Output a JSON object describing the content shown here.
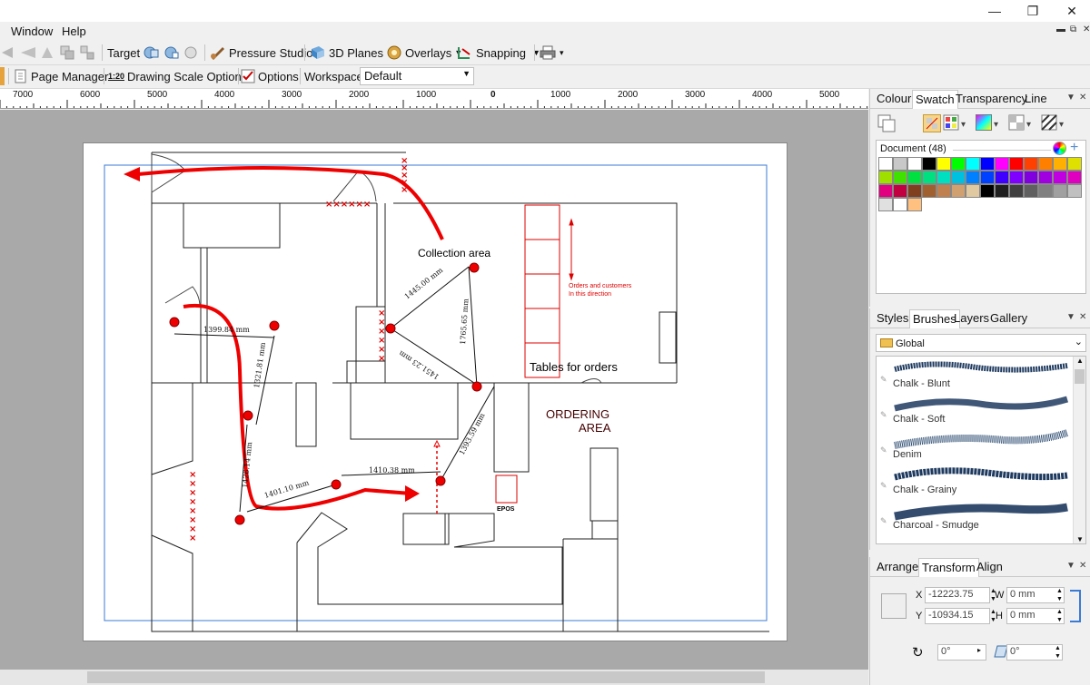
{
  "menu": {
    "window": "Window",
    "help": "Help"
  },
  "toolbar1": {
    "target": "Target",
    "pressure_studio": "Pressure Studio",
    "planes_3d": "3D Planes",
    "overlays": "Overlays",
    "snapping": "Snapping"
  },
  "toolbar2": {
    "page_manager": "Page Manager",
    "scale_badge": "1:20",
    "drawing_scale_options": "Drawing Scale Options",
    "options": "Options",
    "workspace_label": "Workspace",
    "workspace_value": "Default"
  },
  "ruler": {
    "labels": [
      "7000",
      "6000",
      "5000",
      "4000",
      "3000",
      "2000",
      "1000",
      "0",
      "1000",
      "2000",
      "3000",
      "4000",
      "5000"
    ]
  },
  "drawing": {
    "collection_area": "Collection area",
    "orders_direction_1": "Orders and customers",
    "orders_direction_2": "In this direction",
    "tables_for_orders": "Tables for orders",
    "ordering_1": "ORDERING",
    "ordering_2": "AREA",
    "epos": "EPOS",
    "dims": [
      "1399.84 mm",
      "1321.81 mm",
      "1445.00 mm",
      "1765.65 mm",
      "1451.23 mm",
      "1426.14 mm",
      "1401.10 mm",
      "1410.38 mm",
      "1393.59 mm"
    ]
  },
  "colour_panel": {
    "tabs": [
      "Colour",
      "Swatch",
      "Transparency",
      "Line"
    ],
    "active_tab": "Swatch",
    "document_label": "Document (48)",
    "swatches": [
      "#ffffff",
      "#c8c8c8",
      "#ffffff",
      "#000000",
      "#ffff00",
      "#00ff00",
      "#00ffff",
      "#0000ff",
      "#ff00ff",
      "#ff0000",
      "#ff4000",
      "#ff8000",
      "#ffb000",
      "#e0e000",
      "#a0e000",
      "#40e000",
      "#00e040",
      "#00e080",
      "#00e0c0",
      "#00c0e0",
      "#0080ff",
      "#0040ff",
      "#4000ff",
      "#8000ff",
      "#8000e0",
      "#a000e0",
      "#c000e0",
      "#e000c0",
      "#e00080",
      "#c00040",
      "#804020",
      "#a06030",
      "#c08050",
      "#d0a070",
      "#e0c8a0",
      "#000000",
      "#202020",
      "#404040",
      "#606060",
      "#808080",
      "#a0a0a0",
      "#c0c0c0",
      "#e0e0e0",
      "#ffffff",
      "#ffc080"
    ]
  },
  "brushes_panel": {
    "tabs": [
      "Styles",
      "Brushes",
      "Layers",
      "Gallery"
    ],
    "active_tab": "Brushes",
    "category": "Global",
    "items": [
      "Chalk - Blunt",
      "Chalk - Soft",
      "Denim",
      "Chalk - Grainy",
      "Charcoal - Smudge"
    ]
  },
  "transform_panel": {
    "tabs": [
      "Arrange",
      "Transform",
      "Align"
    ],
    "active_tab": "Transform",
    "x_label": "X",
    "x_value": "-12223.75",
    "y_label": "Y",
    "y_value": "-10934.15",
    "w_label": "W",
    "w_value": "0 mm",
    "h_label": "H",
    "h_value": "0 mm",
    "rotate_value": "0°",
    "shear_value": "0°"
  }
}
